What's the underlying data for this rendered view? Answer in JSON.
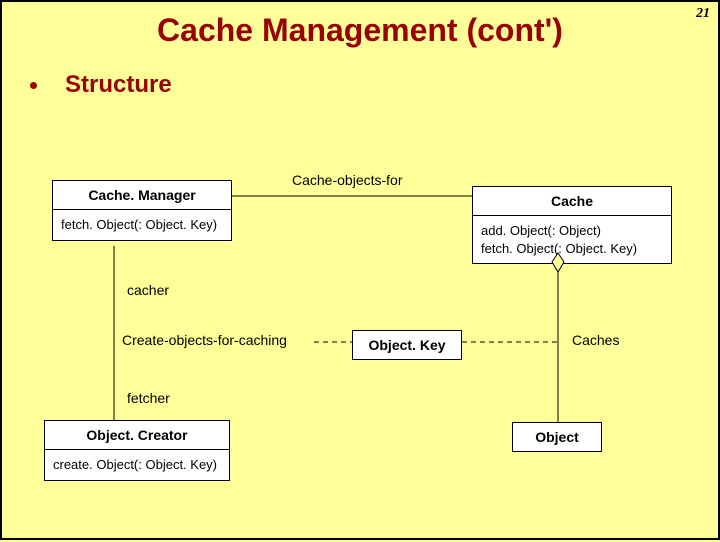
{
  "page_number": "21",
  "title": "Cache Management (cont')",
  "bullet": "Structure",
  "classes": {
    "cache_manager": {
      "name": "Cache. Manager",
      "ops": [
        "fetch. Object(: Object. Key)"
      ]
    },
    "cache": {
      "name": "Cache",
      "ops": [
        "add. Object(: Object)",
        "fetch. Object(: Object. Key)"
      ]
    },
    "object_creator": {
      "name": "Object. Creator",
      "ops": [
        "create. Object(: Object. Key)"
      ]
    },
    "object_key": {
      "name": "Object. Key"
    },
    "object": {
      "name": "Object"
    }
  },
  "assoc": {
    "cache_objects_for": "Cache-objects-for",
    "cacher": "cacher",
    "create_objects_for_caching": "Create-objects-for-caching",
    "fetcher": "fetcher",
    "caches": "Caches"
  }
}
